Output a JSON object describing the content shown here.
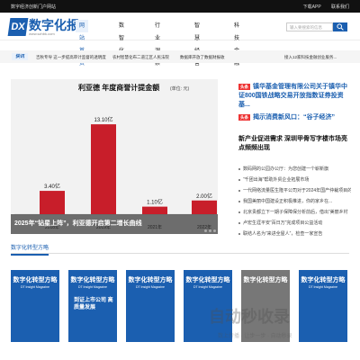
{
  "topbar": {
    "left": "数字经济创新门户网站",
    "right_items": [
      "下载APP",
      "联系我们"
    ]
  },
  "logo": {
    "mark": "DX",
    "text": "数字化报",
    "sub": "www.szhbk.com"
  },
  "nav": {
    "items": [
      {
        "label": "网站首页",
        "active": true
      },
      {
        "label": "数智化",
        "active": false
      },
      {
        "label": "行业洞察",
        "active": false
      },
      {
        "label": "智慧经营",
        "active": false
      },
      {
        "label": "科技金融",
        "active": false
      }
    ]
  },
  "search": {
    "placeholder": "输入要搜索的信息"
  },
  "ticker": {
    "badge": "快讯",
    "items": [
      "吉秋专导 这一步提高审计监督的透明度",
      "农村智慧化布二道江区人民法院",
      "数据库开放了数据财报收",
      "接入12家科技金融创业服务..."
    ]
  },
  "chart_data": {
    "type": "bar",
    "title": "利亚德 年度商誉计提金额",
    "unit": "(单位: 元)",
    "categories": [
      "2018年",
      "2019年",
      "2021年",
      "2022年"
    ],
    "values": [
      3.4,
      13.1,
      1.1,
      2.0
    ],
    "value_labels": [
      "3.40亿",
      "13.10亿",
      "1.10亿",
      "2.00亿"
    ],
    "ylim": [
      0,
      16
    ],
    "colors": {
      "bar": "#c81e2a",
      "background": "#f2f2f2"
    }
  },
  "slider": {
    "caption": "2025年“钻星上阵”，利亚德开启第二增长曲线",
    "dots": 3
  },
  "news": {
    "top_tag": "头条",
    "top_headline": "镇华基金管理有限公司关于镇华中证800国铁战略交易开放指数证券投资基...",
    "second_tag": "头条",
    "second_headline": "揭示消费新风口：“谷子经济”",
    "feature_headline": "新产业促进需求 深圳甲骨写字楼市场亮点频频出现",
    "list": [
      "数码网的公园办公厅：为您创建一个崭新旗",
      "“千团出海”帮助外贸企业拓展市场",
      "一代网络流量医生隆平公司对于2024年国产仲裁项目的...",
      "我国美丽中国建设正积极推进，你的家乡在...",
      "北京贵都立下一期子保障保分析前后，借出“美丽乡村",
      "卢宏生涯平安“百日万”完成项目公益活动",
      "联结人名为“来进全屋人”，检查一家宣告"
    ]
  },
  "section": {
    "title": "数字化转型方略"
  },
  "magazines": [
    {
      "title": "数字化转型方略",
      "sub": "DT Insight Magazine",
      "issue": "",
      "grey": false
    },
    {
      "title": "数字化转型方略",
      "sub": "DT Insight Magazine",
      "issue": "到证上市公司 高质量发展",
      "grey": false
    },
    {
      "title": "数字化转型方略",
      "sub": "DT Insight Magazine",
      "issue": "",
      "grey": false
    },
    {
      "title": "数字化转型方略",
      "sub": "DT Insight Magazine",
      "issue": "",
      "grey": false
    },
    {
      "title": "数字化转型方略",
      "sub": "",
      "issue": "",
      "grey": true
    },
    {
      "title": "数字化转型方略",
      "sub": "DT Insight Magazine",
      "issue": "",
      "grey": false
    }
  ],
  "watermark": {
    "text": "自动秒收录",
    "sub": "数上传播 · 让步一步 · 自动秒录"
  }
}
